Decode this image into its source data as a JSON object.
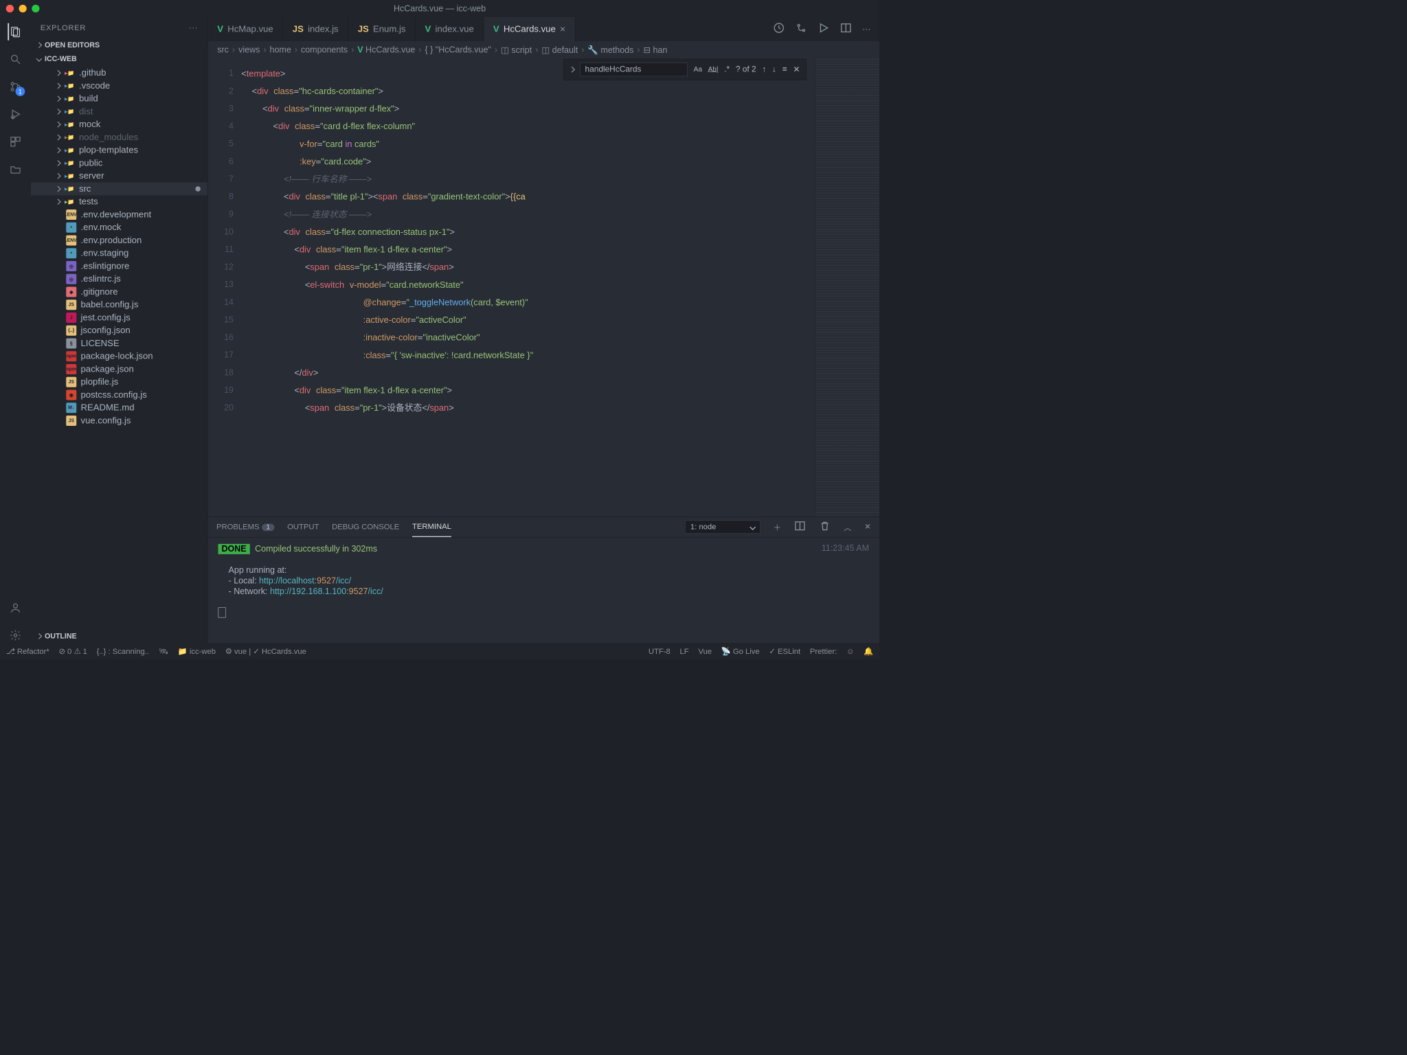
{
  "window": {
    "title": "HcCards.vue — icc-web"
  },
  "explorer": {
    "title": "EXPLORER",
    "open_editors": "OPEN EDITORS",
    "project": "ICC-WEB",
    "outline": "OUTLINE"
  },
  "tree": [
    {
      "name": ".github",
      "kind": "folder",
      "color": "#e06c75",
      "chev": true
    },
    {
      "name": ".vscode",
      "kind": "folder",
      "color": "#519aba",
      "chev": true
    },
    {
      "name": "build",
      "kind": "folder",
      "color": "#519aba",
      "chev": true
    },
    {
      "name": "dist",
      "kind": "folder",
      "color": "#519aba",
      "chev": true,
      "dim": true
    },
    {
      "name": "mock",
      "kind": "folder",
      "color": "#519aba",
      "chev": true
    },
    {
      "name": "node_modules",
      "kind": "folder",
      "color": "#8a8a4a",
      "chev": true,
      "dim": true
    },
    {
      "name": "plop-templates",
      "kind": "folder",
      "color": "#519aba",
      "chev": true
    },
    {
      "name": "public",
      "kind": "folder",
      "color": "#519aba",
      "chev": true
    },
    {
      "name": "server",
      "kind": "folder",
      "color": "#519aba",
      "chev": true
    },
    {
      "name": "src",
      "kind": "folder",
      "color": "#519aba",
      "chev": true,
      "sel": true,
      "mod": true
    },
    {
      "name": "tests",
      "kind": "folder",
      "color": "#98c379",
      "chev": true
    },
    {
      "name": ".env.development",
      "kind": "file",
      "badge": ".ENV",
      "bg": "#e5c07b"
    },
    {
      "name": ".env.mock",
      "kind": "file",
      "badge": "•",
      "bg": "#519aba"
    },
    {
      "name": ".env.production",
      "kind": "file",
      "badge": ".ENV",
      "bg": "#e5c07b"
    },
    {
      "name": ".env.staging",
      "kind": "file",
      "badge": "•",
      "bg": "#519aba"
    },
    {
      "name": ".eslintignore",
      "kind": "file",
      "badge": "◎",
      "bg": "#7c63c3"
    },
    {
      "name": ".eslintrc.js",
      "kind": "file",
      "badge": "◎",
      "bg": "#7c63c3"
    },
    {
      "name": ".gitignore",
      "kind": "file",
      "badge": "◆",
      "bg": "#e06c75"
    },
    {
      "name": "babel.config.js",
      "kind": "file",
      "badge": "JS",
      "bg": "#e5c07b"
    },
    {
      "name": "jest.config.js",
      "kind": "file",
      "badge": "J",
      "bg": "#c2185b"
    },
    {
      "name": "jsconfig.json",
      "kind": "file",
      "badge": "{..}",
      "bg": "#e5c07b"
    },
    {
      "name": "LICENSE",
      "kind": "file",
      "badge": "§",
      "bg": "#8a919c"
    },
    {
      "name": "package-lock.json",
      "kind": "file",
      "badge": "npm",
      "bg": "#cb3837"
    },
    {
      "name": "package.json",
      "kind": "file",
      "badge": "npm",
      "bg": "#cb3837"
    },
    {
      "name": "plopfile.js",
      "kind": "file",
      "badge": "JS",
      "bg": "#e5c07b"
    },
    {
      "name": "postcss.config.js",
      "kind": "file",
      "badge": "◉",
      "bg": "#d6452c"
    },
    {
      "name": "README.md",
      "kind": "file",
      "badge": "M↓",
      "bg": "#519aba"
    },
    {
      "name": "vue.config.js",
      "kind": "file",
      "badge": "JS",
      "bg": "#e5c07b"
    }
  ],
  "tabs": [
    {
      "label": "HcMap.vue",
      "icon": "vue",
      "iconColor": "#41b883"
    },
    {
      "label": "index.js",
      "icon": "JS",
      "iconColor": "#e5c07b"
    },
    {
      "label": "Enum.js",
      "icon": "JS",
      "iconColor": "#e5c07b"
    },
    {
      "label": "index.vue",
      "icon": "vue",
      "iconColor": "#41b883"
    },
    {
      "label": "HcCards.vue",
      "icon": "vue",
      "iconColor": "#41b883",
      "active": true,
      "close": true
    }
  ],
  "breadcrumbs": [
    "src",
    "views",
    "home",
    "components",
    "HcCards.vue",
    "\"HcCards.vue\"",
    "script",
    "default",
    "methods",
    "han"
  ],
  "find": {
    "value": "handleHcCards",
    "result": "? of 2"
  },
  "code_lines": [
    "1",
    "2",
    "3",
    "4",
    "5",
    "6",
    "7",
    "8",
    "9",
    "10",
    "11",
    "12",
    "13",
    "14",
    "15",
    "16",
    "17",
    "18",
    "19",
    "20"
  ],
  "panel": {
    "tabs": {
      "problems": "PROBLEMS",
      "problems_count": "1",
      "output": "OUTPUT",
      "debug": "DEBUG CONSOLE",
      "terminal": "TERMINAL"
    },
    "select": "1: node",
    "done": "DONE",
    "compiled": "Compiled successfully in 302ms",
    "running": "App running at:",
    "local_label": "- Local:   ",
    "local_url_1": "http://localhost:",
    "local_port": "9527",
    "local_url_2": "/icc/",
    "net_label": "- Network: ",
    "net_url_1": "http://192.168.1.100:",
    "net_port": "9527",
    "net_url_2": "/icc/",
    "timestamp": "11:23:45 AM"
  },
  "status": {
    "refactor": "Refactor*",
    "errors": "0",
    "warnings": "1",
    "scanning": "{..} : Scanning..",
    "folder": "icc-web",
    "vue": "vue",
    "branch": "HcCards.vue",
    "encoding": "UTF-8",
    "eol": "LF",
    "lang": "Vue",
    "golive": "Go Live",
    "eslint": "ESLint",
    "prettier": "Prettier: "
  },
  "scm_badge": "1"
}
